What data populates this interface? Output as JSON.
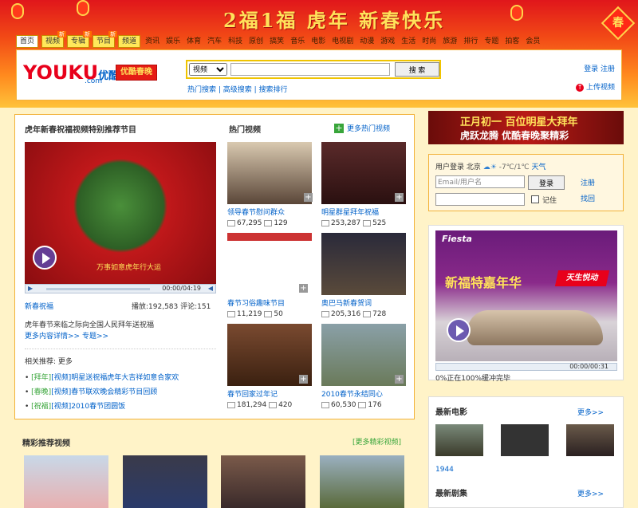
{
  "banner": {
    "title": "2福1福 虎年 新春快乐",
    "corner": "春"
  },
  "nav": {
    "tabs": [
      {
        "label": "首页",
        "badge": ""
      },
      {
        "label": "视频",
        "badge": "新"
      },
      {
        "label": "专辑",
        "badge": "新"
      },
      {
        "label": "节目",
        "badge": "新"
      },
      {
        "label": "频道",
        "badge": ""
      }
    ],
    "links": [
      "资讯",
      "娱乐",
      "体育",
      "汽车",
      "科技",
      "原创",
      "搞笑",
      "音乐",
      "电影",
      "电视剧",
      "动漫",
      "游戏",
      "生活",
      "时尚",
      "旅游",
      "排行",
      "专题",
      "拍客",
      "会员"
    ]
  },
  "header": {
    "logo_main": "YOUKU",
    "logo_cn": "优酷",
    "logo_sub": ".com",
    "chunwan": "优酷春晚",
    "search_select": "视频",
    "search_placeholder": "",
    "search_button": "搜 索",
    "search_links": "热门搜索 | 高级搜索 | 搜索排行",
    "right_1": "登录 注册",
    "right_2": "上传视频"
  },
  "main": {
    "feature_title": "虎年新春祝福视频特别推荐节目",
    "player_caption": "万事如意虎年行大运",
    "player_time": "00:00/04:19",
    "feature_name": "新春祝福",
    "feature_stats": "播放:192,583 评论:151",
    "feature_desc_1": "虎年春节来临之际向全国人民拜年送祝福",
    "feature_desc_2": "更多内容详情>> 专题>>",
    "related_title": "相关推荐: 更多",
    "list": [
      {
        "tag": "[拜年]",
        "text": "[视频]明星送祝福虎年大吉祥如意合家欢"
      },
      {
        "tag": "[春晚]",
        "text": "[视频]春节联欢晚会精彩节目回顾"
      },
      {
        "tag": "[祝福]",
        "text": "[视频]2010春节团圆饭"
      }
    ],
    "hot_title": "热门视频",
    "hot_more": "更多热门视频",
    "thumbs": [
      {
        "title": "领导春节慰问群众",
        "plays": "67,295",
        "comments": "129"
      },
      {
        "title": "明星群星拜年祝福",
        "plays": "253,287",
        "comments": "525"
      },
      {
        "title": "春节习俗趣味节目",
        "plays": "11,219",
        "comments": "50"
      },
      {
        "title": "奥巴马新春贺词",
        "plays": "205,316",
        "comments": "728"
      },
      {
        "title": "春节回家过年记",
        "plays": "181,294",
        "comments": "420"
      },
      {
        "title": "2010春节永结同心",
        "plays": "60,530",
        "comments": "176"
      }
    ],
    "bottom_title": "精彩推荐视频",
    "bottom_more": "[更多精彩视频]"
  },
  "right": {
    "banner_1": "正月初一 百位明星大拜年",
    "banner_2": "虎跃龙腾 优酷春晚聚精彩",
    "login_title": "用户登录 北京",
    "weather": "-7℃/1℃",
    "weather_link": "天气",
    "email_placeholder": "Email/用户名",
    "login_button": "登录",
    "remember": "记住",
    "register": "注册",
    "forgot": "找回",
    "ad_brand": "Fiesta",
    "ad_slogan": "新福特嘉年华",
    "ad_tag": "天生悦动",
    "ad_time": "00:00/00:31",
    "ad_status": "0%正在100%缓冲完毕",
    "rec_title": "最新电影",
    "rec_more": "更多>>",
    "rec_items": [
      {
        "title": "1944"
      },
      {
        "title": ""
      },
      {
        "title": ""
      }
    ],
    "rec2_title": "最新剧集",
    "rec2_more": "更多>>"
  }
}
